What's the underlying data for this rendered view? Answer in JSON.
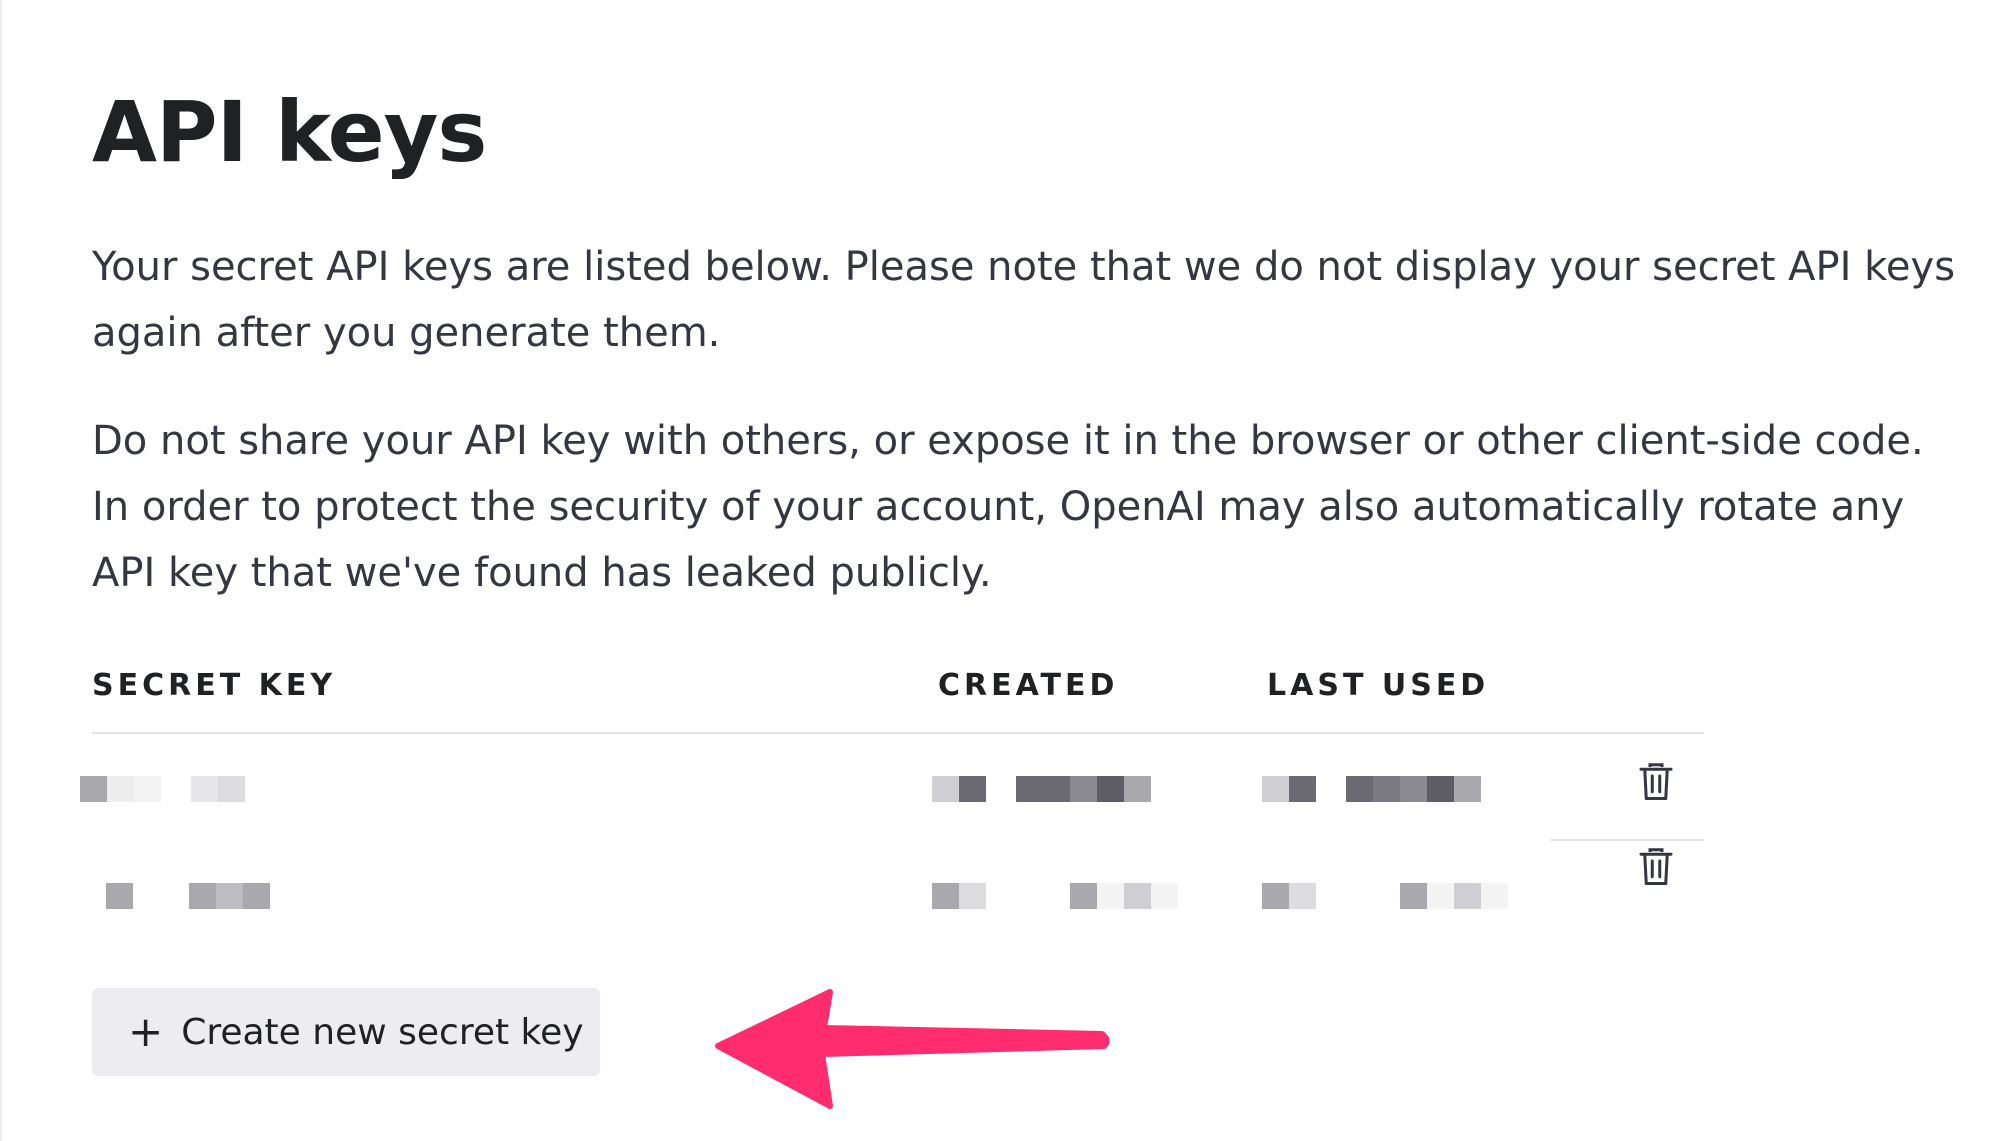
{
  "page": {
    "title": "API keys",
    "description_1": "Your secret API keys are listed below. Please note that we do not display your secret API keys again after you generate them.",
    "description_2": "Do not share your API key with others, or expose it in the browser or other client-side code. In order to protect the security of your account, OpenAI may also automatically rotate any API key that we've found has leaked publicly."
  },
  "table": {
    "headers": {
      "secret_key": "SECRET KEY",
      "created": "CREATED",
      "last_used": "LAST USED"
    },
    "rows": [
      {
        "secret_key": "redacted",
        "created": "redacted",
        "last_used": "redacted",
        "delete_icon": "trash-icon"
      },
      {
        "secret_key": "redacted",
        "created": "redacted",
        "last_used": "redacted",
        "delete_icon": "trash-icon"
      }
    ]
  },
  "actions": {
    "create_icon": "plus-icon",
    "create_label": "Create new secret key"
  },
  "annotation": {
    "arrow_color": "#ff2d6f"
  },
  "colors": {
    "text": "#202123",
    "body_text": "#353740",
    "button_bg": "#ececf1",
    "divider": "#e5e5e8"
  }
}
